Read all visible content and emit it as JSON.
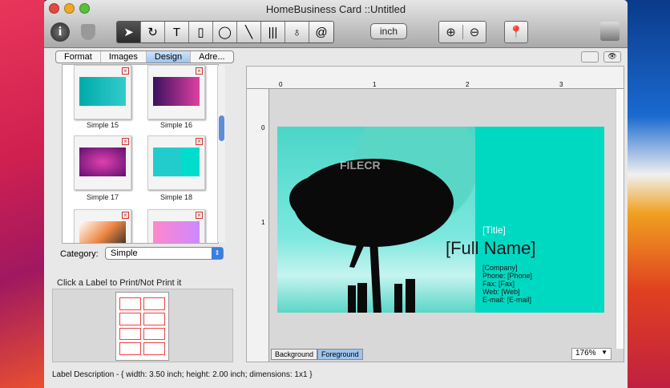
{
  "window": {
    "title": "HomeBusiness Card ::Untitled"
  },
  "toolbar": {
    "unit_label": "inch",
    "tools": [
      "select",
      "rotate",
      "text",
      "rectangle",
      "ellipse",
      "line",
      "barcode",
      "image",
      "at"
    ]
  },
  "tabs": [
    {
      "label": "Format"
    },
    {
      "label": "Images"
    },
    {
      "label": "Design",
      "active": true
    },
    {
      "label": "Adre..."
    }
  ],
  "gallery": {
    "items": [
      {
        "label": "Simple 15"
      },
      {
        "label": "Simple 16"
      },
      {
        "label": "Simple 17"
      },
      {
        "label": "Simple 18"
      },
      {
        "label": ""
      },
      {
        "label": ""
      }
    ]
  },
  "category": {
    "label": "Category:",
    "value": "Simple"
  },
  "print_hint": "Click a Label to Print/Not Print it",
  "ruler": {
    "h": [
      "0",
      "1",
      "2",
      "3"
    ],
    "v": [
      "0",
      "1"
    ]
  },
  "card": {
    "title": "[Title]",
    "name": "[Full Name]",
    "lines": [
      "[Company]",
      "Phone:  [Phone]",
      "Fax:  [Fax]",
      "Web:  [Web]",
      "E-mail:  [E-mail]"
    ],
    "watermark": "FILECR"
  },
  "layers": {
    "background": "Background",
    "foreground": "Foreground"
  },
  "zoom": "176%",
  "status": "Label Description - { width: 3.50 inch; height: 2.00 inch; dimensions: 1x1 }"
}
